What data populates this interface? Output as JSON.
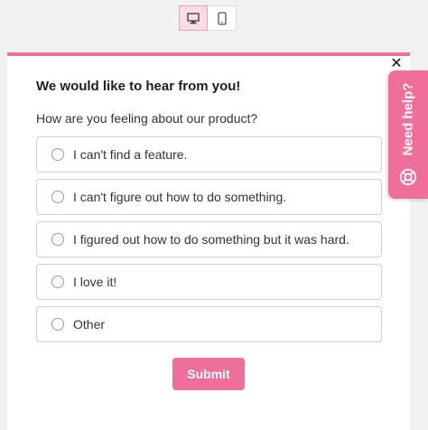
{
  "toolbar": {
    "views": [
      {
        "icon": "desktop-icon",
        "active": true
      },
      {
        "icon": "mobile-icon",
        "active": false
      }
    ]
  },
  "survey": {
    "title": "We would like to hear from you!",
    "question": "How are you feeling about our product?",
    "options": [
      "I can't find a feature.",
      "I can't figure out how to do something.",
      "I figured out how to do something but it was hard.",
      "I love it!",
      "Other"
    ],
    "submit_label": "Submit",
    "close_icon": "close-icon"
  },
  "help_tab": {
    "label": "Need help?",
    "icon": "lifebuoy-icon"
  },
  "colors": {
    "accent": "#ef6f9a",
    "active_toggle_bg": "#f9dce5"
  }
}
